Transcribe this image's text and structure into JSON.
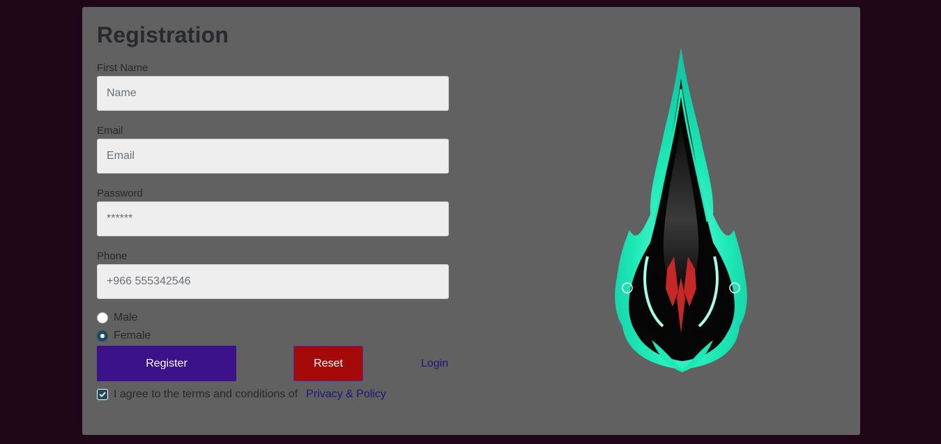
{
  "form": {
    "title": "Registration",
    "first_name": {
      "label": "First Name",
      "placeholder": "Name"
    },
    "email": {
      "label": "Email",
      "placeholder": "Email"
    },
    "password": {
      "label": "Password",
      "placeholder": "******"
    },
    "phone": {
      "label": "Phone",
      "placeholder": "+966 555342546"
    },
    "gender": {
      "options": [
        {
          "label": "Male",
          "checked": false
        },
        {
          "label": "Female",
          "checked": true
        }
      ]
    },
    "register_label": "Register",
    "reset_label": "Reset",
    "login_label": "Login",
    "agree_text": "I agree to the terms and conditions of",
    "policy_link": "Privacy & Policy",
    "agree_checked": true
  },
  "logo": {
    "icon": "teal-blade-emblem-icon",
    "colors": {
      "teal": "#1de9b6",
      "black": "#050505",
      "red": "#c62828"
    }
  },
  "colors": {
    "page_background": "#1f0717",
    "card_background": "#616161",
    "register_button": "#3b1289",
    "reset_button": "#a50a0a",
    "link": "#1e1678"
  }
}
